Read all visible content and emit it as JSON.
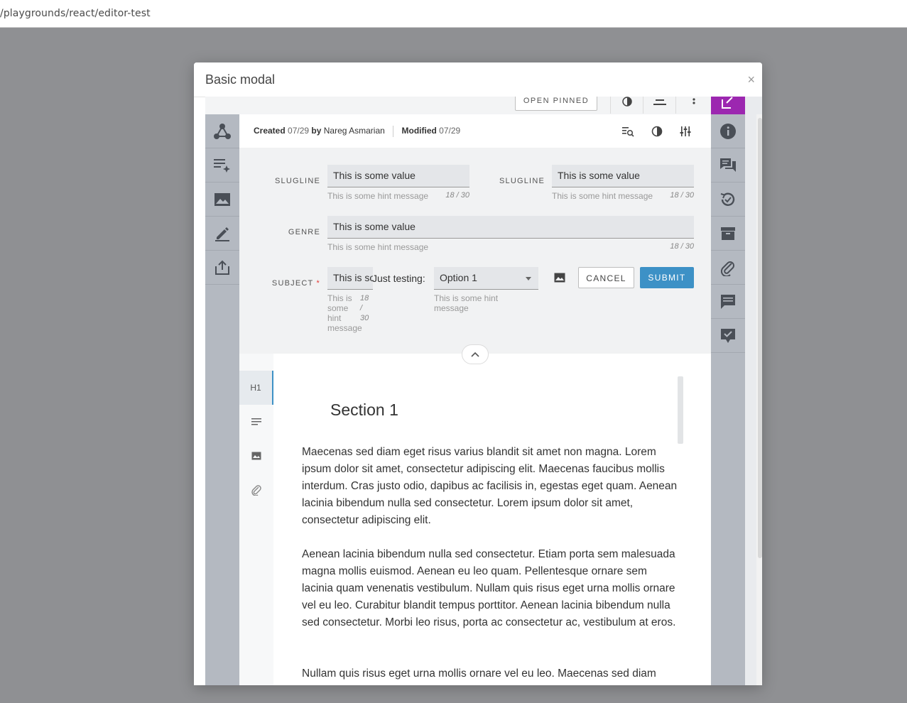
{
  "browser": {
    "address": "/playgrounds/react/editor-test"
  },
  "modal": {
    "title": "Basic modal",
    "close_label": "×",
    "toolbar": {
      "open_pinned": "OPEN PINNED"
    },
    "meta": {
      "created_label": "Created",
      "created_date": "07/29",
      "by_label": "by",
      "author": "Nareg Asmarian",
      "modified_label": "Modified",
      "modified_date": "07/29"
    },
    "form": {
      "slugline_label": "SLUGLINE",
      "slugline_value": "This is some value",
      "slugline_hint": "This is some hint message",
      "slugline_count": "18 / 30",
      "slugline2_label": "SLUGLINE",
      "slugline2_value": "This is some value",
      "slugline2_hint": "This is some hint message",
      "slugline2_count": "18 / 30",
      "genre_label": "GENRE",
      "genre_value": "This is some value",
      "genre_hint": "This is some hint message",
      "genre_count": "18 / 30",
      "subject_label": "SUBJECT",
      "subject_required": "*",
      "subject_value": "This is some value",
      "subject_hint": "This is some hint message",
      "subject_count": "18 / 30",
      "testing_label": "Just testing:",
      "select_value": "Option 1",
      "select_hint": "This is some hint message",
      "cancel_label": "CANCEL",
      "submit_label": "SUBMIT"
    },
    "editor": {
      "tabs": [
        "H1"
      ],
      "section_title": "Section 1",
      "paragraphs": [
        "Maecenas sed diam eget risus varius blandit sit amet non magna. Lorem ipsum dolor sit amet, consectetur adipiscing elit. Maecenas faucibus mollis interdum. Cras justo odio, dapibus ac facilisis in, egestas eget quam. Aenean lacinia bibendum nulla sed consectetur. Lorem ipsum dolor sit amet, consectetur adipiscing elit.",
        "Aenean lacinia bibendum nulla sed consectetur. Etiam porta sem malesuada magna mollis euismod. Aenean eu leo quam. Pellentesque ornare sem lacinia quam venenatis vestibulum. Nullam quis risus eget urna mollis ornare vel eu leo. Curabitur blandit tempus porttitor. Aenean lacinia bibendum nulla sed consectetur. Morbi leo risus, porta ac consectetur ac, vestibulum at eros.",
        "Nullam quis risus eget urna mollis ornare vel eu leo. Maecenas sed diam"
      ]
    }
  },
  "colors": {
    "accent": "#9c27b0",
    "primary": "#3d91c6",
    "nav": "#b4b9c1"
  },
  "icons": {
    "left_nav": [
      "graph-icon",
      "text-magic-icon",
      "image-icon",
      "edit-icon",
      "export-icon"
    ],
    "right_nav": [
      "edit-box-icon",
      "info-icon",
      "comments-icon",
      "history-check-icon",
      "archive-icon",
      "attachment-icon",
      "message-icon",
      "checkbox-message-icon"
    ]
  }
}
